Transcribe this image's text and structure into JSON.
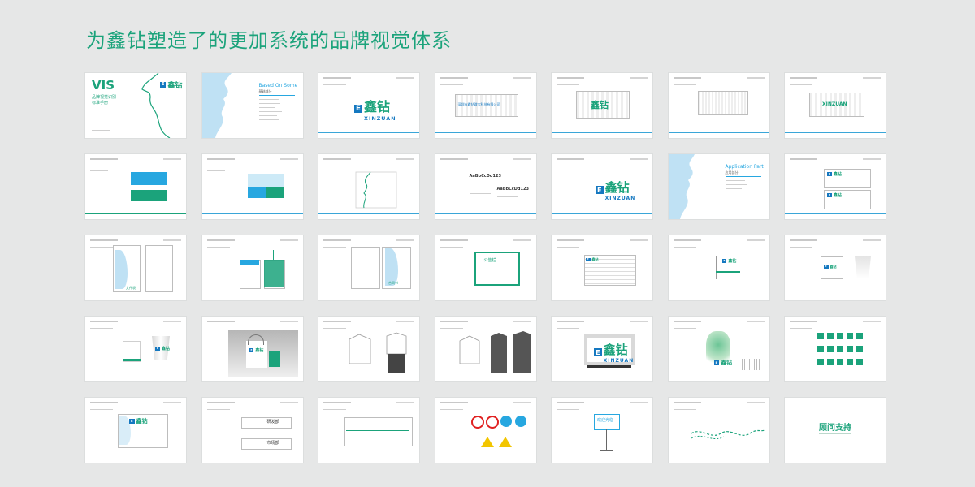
{
  "headline": "为鑫钻塑造了的更加系统的品牌视觉体系",
  "cover": {
    "vis": "VIS",
    "subtitle_1": "品牌视觉识别",
    "subtitle_2": "标准手册"
  },
  "brand": {
    "logo_cn": "鑫钻",
    "logo_en": "XINZUAN",
    "company_name": "深圳市鑫钻珠宝科技有限公司"
  },
  "sections": {
    "based_on_some": "Based On Some",
    "based_on_some_cn": "基础部分",
    "application_part": "Application Part",
    "application_part_cn": "应用部分"
  },
  "samples": {
    "font_sample_1": "AaBbCcDd123",
    "font_sample_2": "AaBbCcDd123",
    "bulletin": "公告栏",
    "card_1": "文件袋",
    "card_2": "合同书",
    "dept_1": "研发部",
    "dept_2": "市场部",
    "welcome_sign": "欢迎光临"
  },
  "closing": "顾问支持",
  "colors": {
    "brand_green": "#1ba37b",
    "brand_blue": "#1578c0",
    "sky_blue": "#27a7e0",
    "pale_blue": "#bfe1f4",
    "background": "#e6e7e7"
  }
}
